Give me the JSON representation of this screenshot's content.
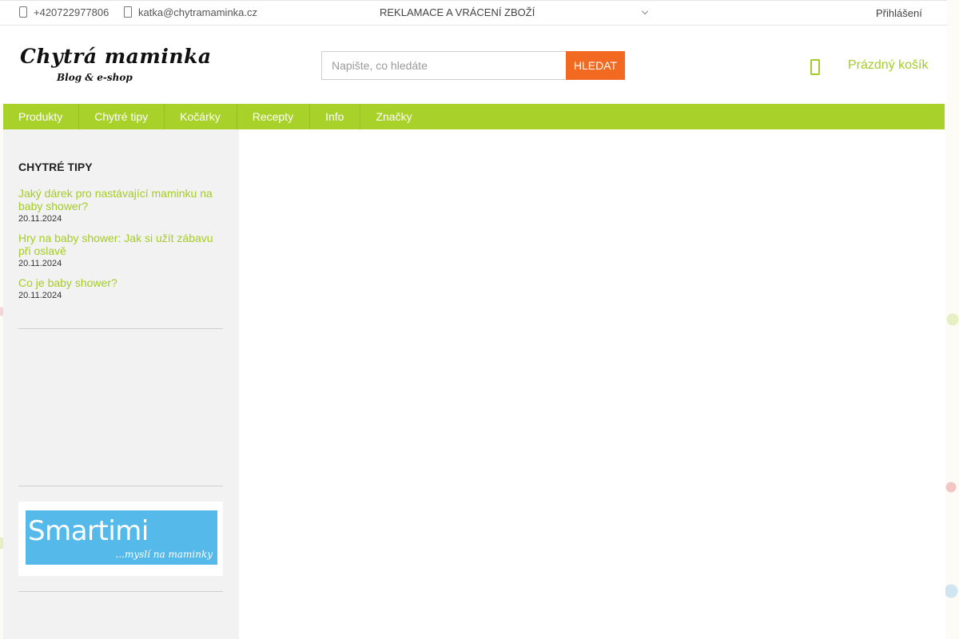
{
  "topbar": {
    "phone": "+420722977806",
    "email": "katka@chytramaminka.cz",
    "returns_link": "REKLAMACE A VRÁCENÍ ZBOŽÍ",
    "login_link": "Přihlášení"
  },
  "header": {
    "logo_main": "Chytrá maminka",
    "logo_sub": "Blog & e-shop",
    "search_placeholder": "Napište, co hledáte",
    "search_button": "HLEDAT",
    "cart_label": "Prázdný košík"
  },
  "nav": {
    "items": [
      "Produkty",
      "Chytré tipy",
      "Kočárky",
      "Recepty",
      "Info",
      "Značky"
    ]
  },
  "sidebar": {
    "title": "CHYTRÉ TIPY",
    "posts": [
      {
        "title": "Jaký dárek pro nastávající maminku na baby shower?",
        "date": "20.11.2024"
      },
      {
        "title": "Hry na baby shower: Jak si užít zábavu při oslavě",
        "date": "20.11.2024"
      },
      {
        "title": "Co je baby shower?",
        "date": "20.11.2024"
      }
    ],
    "banner_brand": "Smartimi",
    "banner_tagline": "...myslí na maminky"
  },
  "colors": {
    "accent_green": "#a8d12a",
    "link_green": "#a4cc26",
    "search_button_orange": "#f26a21",
    "banner_blue": "#55b9ea"
  },
  "icons": {
    "phone": "phone-icon",
    "email": "mail-icon",
    "top_dropdown": "chevron-down-icon",
    "cart": "cart-icon"
  }
}
